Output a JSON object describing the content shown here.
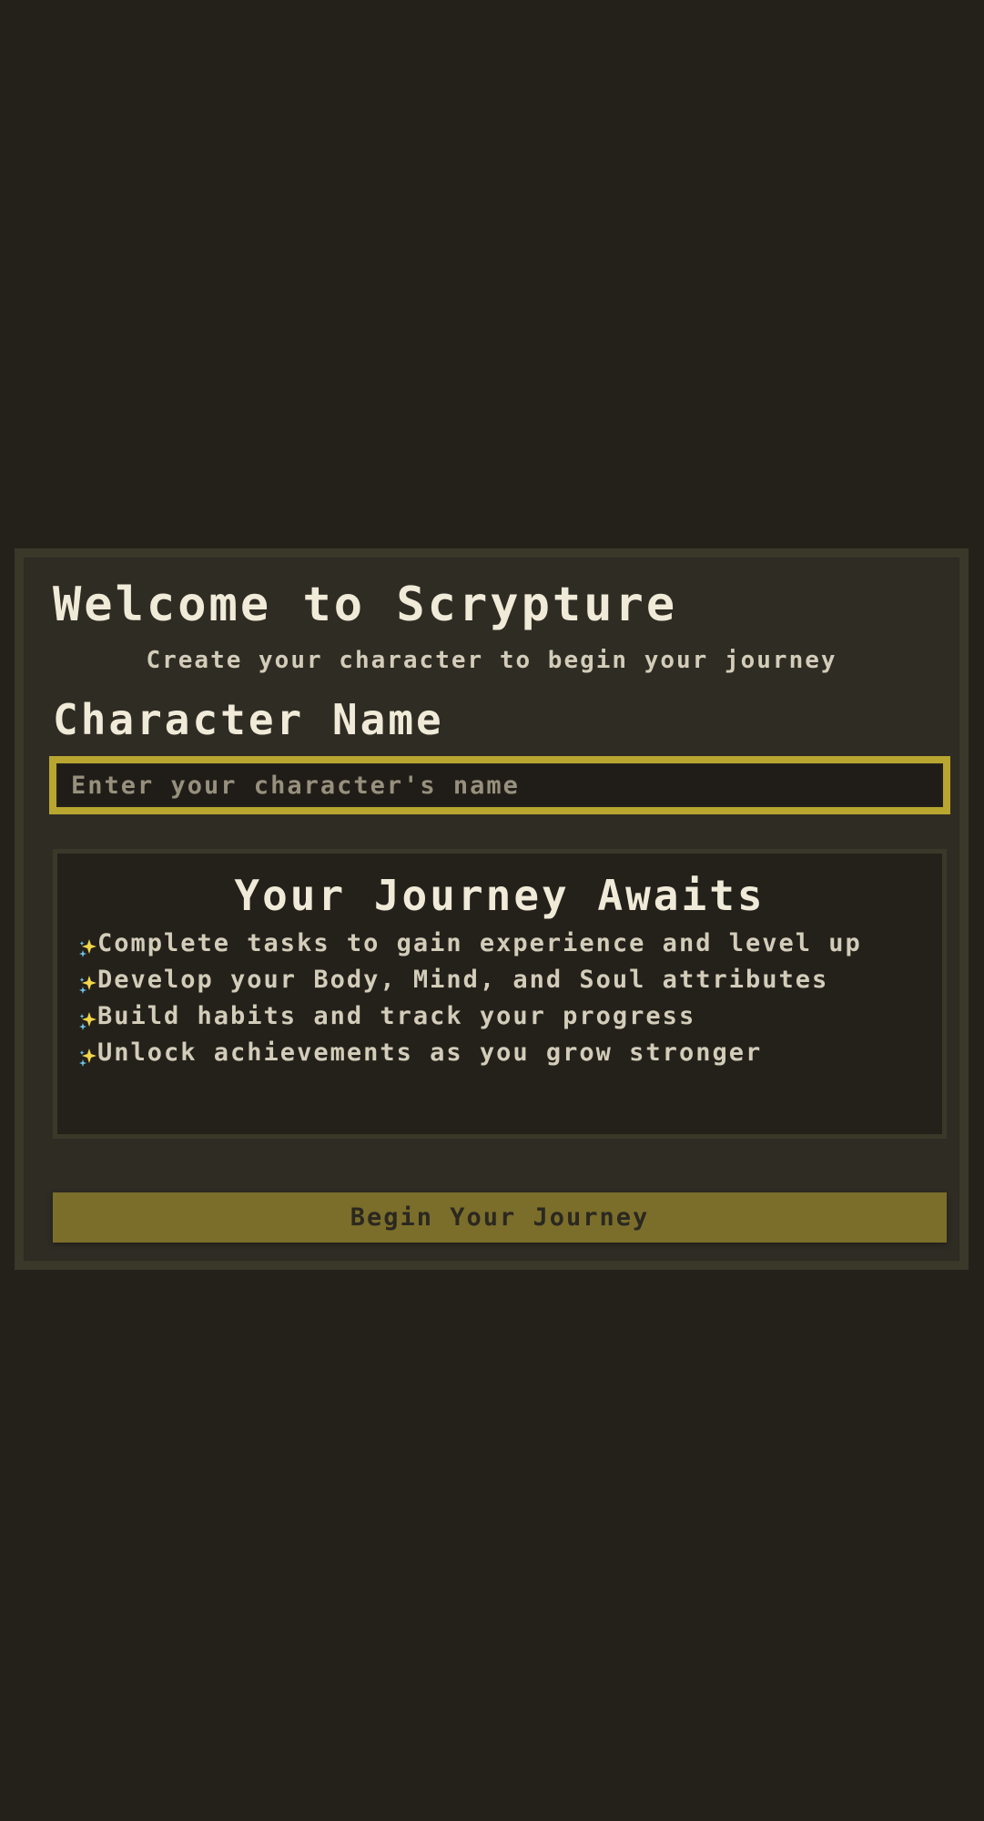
{
  "welcome": {
    "title": "Welcome to Scrypture",
    "subtitle": "Create your character to begin your journey"
  },
  "character": {
    "label": "Character Name",
    "placeholder": "Enter your character's name",
    "value": ""
  },
  "journey": {
    "title": "Your Journey Awaits",
    "bullet_icon": "sparkle-icon",
    "features": [
      "Complete tasks to gain experience and level up",
      "Develop your Body, Mind, and Soul attributes",
      "Build habits and track your progress",
      "Unlock achievements as you grow stronger"
    ]
  },
  "actions": {
    "begin_label": "Begin Your Journey"
  },
  "colors": {
    "page_background": "#24211b",
    "card_background": "#2f2c24",
    "accent": "#b8a630",
    "button": "#7b6e2b",
    "heading_text": "#f0ead8",
    "body_text": "#d2ccb9"
  }
}
